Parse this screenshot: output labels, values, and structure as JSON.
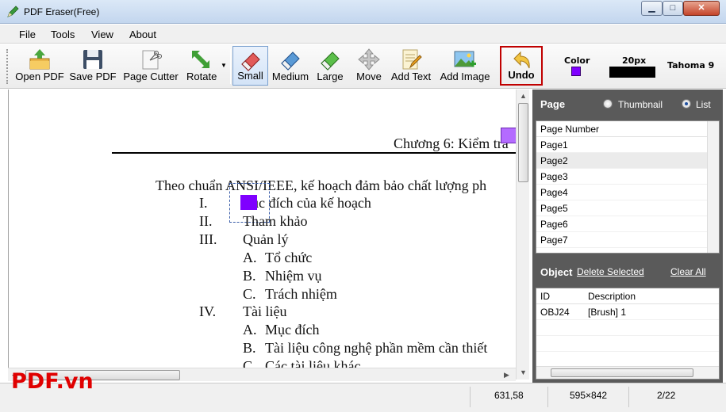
{
  "window": {
    "title": "PDF Eraser(Free)"
  },
  "menu": [
    "File",
    "Tools",
    "View",
    "About"
  ],
  "toolbar": {
    "open": "Open PDF",
    "save": "Save PDF",
    "cutter": "Page Cutter",
    "rotate": "Rotate",
    "small": "Small",
    "medium": "Medium",
    "large": "Large",
    "move": "Move",
    "add_text": "Add Text",
    "add_image": "Add Image",
    "undo": "Undo",
    "color_label": "Color",
    "brush_size": "20px",
    "font_label": "Tahoma 9",
    "brush_color": "#7f00ff"
  },
  "document": {
    "header": "Chương 6: Kiểm tra",
    "intro": "Theo chuẩn ANSI/IEEE, kế hoạch đảm bảo chất lượng ph",
    "lines": [
      {
        "num": "I.",
        "text": "ục đích của kế hoạch"
      },
      {
        "num": "II.",
        "text": "Tham khảo"
      },
      {
        "num": "III.",
        "text": "Quản lý"
      },
      {
        "num": "A.",
        "text": "Tổ chức"
      },
      {
        "num": "B.",
        "text": "Nhiệm vụ"
      },
      {
        "num": "C.",
        "text": "Trách nhiệm"
      },
      {
        "num": "IV.",
        "text": "Tài liệu"
      },
      {
        "num": "A.",
        "text": "Mục đích"
      },
      {
        "num": "B.",
        "text": "Tài liệu công nghệ phần mềm cần thiết"
      },
      {
        "num": "C.",
        "text": "Các tài liệu khác"
      }
    ]
  },
  "page_panel": {
    "title": "Page",
    "option_thumbnail": "Thumbnail",
    "option_list": "List",
    "selected_option": "List",
    "column": "Page Number",
    "pages": [
      "Page1",
      "Page2",
      "Page3",
      "Page4",
      "Page5",
      "Page6",
      "Page7"
    ],
    "selected_page": "Page2"
  },
  "object_panel": {
    "title": "Object",
    "delete_selected": "Delete Selected",
    "clear_all": "Clear All",
    "col_id": "ID",
    "col_desc": "Description",
    "rows": [
      {
        "id": "OBJ24",
        "desc": "[Brush] 1"
      }
    ]
  },
  "status": {
    "coords": "631,58",
    "page_size": "595×842",
    "page_index": "2/22"
  },
  "watermark": "PDF.vn"
}
